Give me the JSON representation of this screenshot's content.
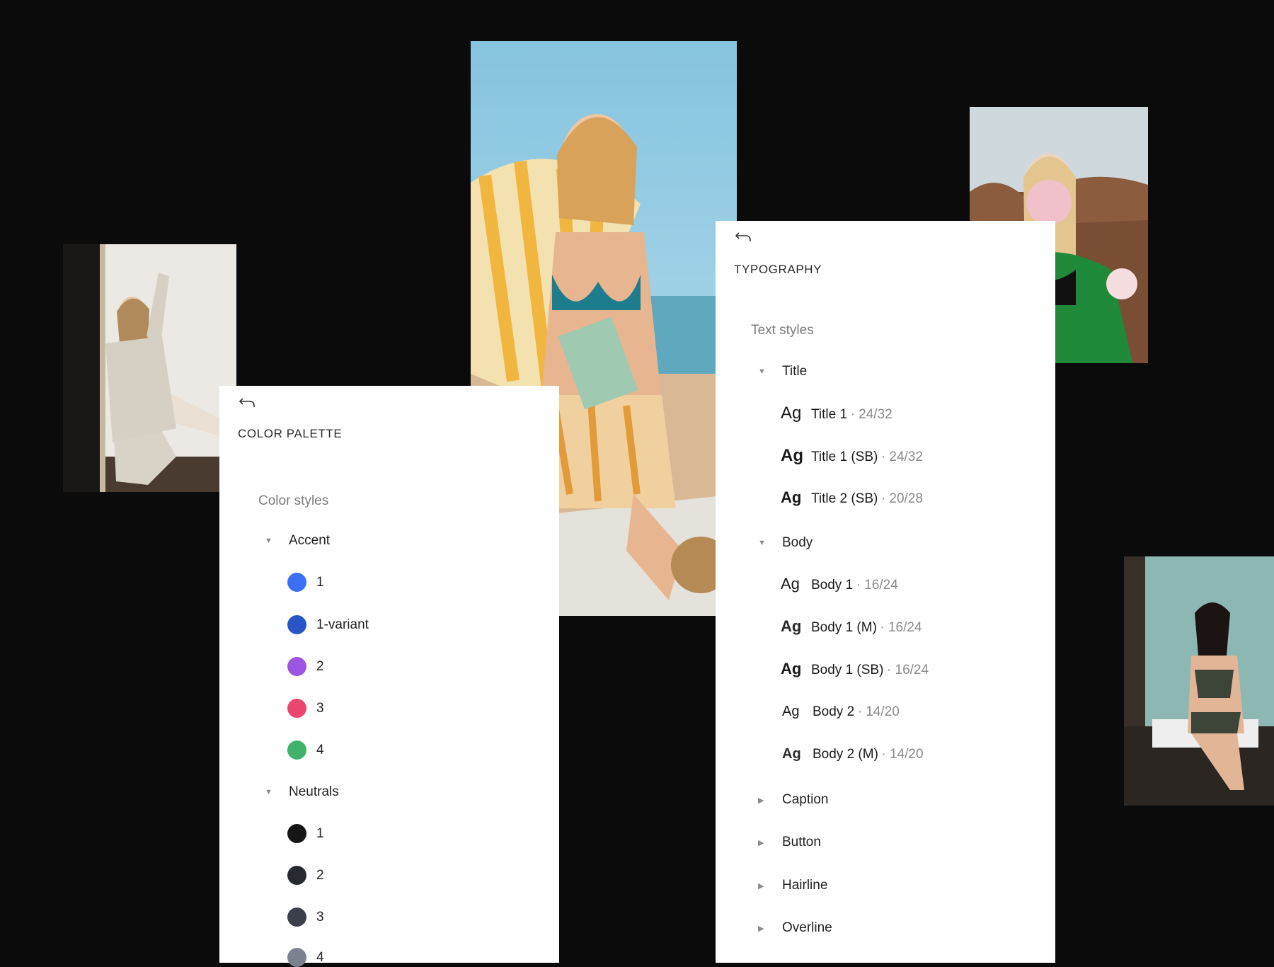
{
  "color_panel": {
    "title": "COLOR PALETTE",
    "section": "Color styles",
    "groups": [
      {
        "label": "Accent",
        "expanded": true,
        "swatches": [
          {
            "label": "1",
            "color": "#3b6ff5"
          },
          {
            "label": "1-variant",
            "color": "#2a55c9"
          },
          {
            "label": "2",
            "color": "#9b55e0"
          },
          {
            "label": "3",
            "color": "#ea4670"
          },
          {
            "label": "4",
            "color": "#3fb36b"
          }
        ]
      },
      {
        "label": "Neutrals",
        "expanded": true,
        "swatches": [
          {
            "label": "1",
            "color": "#161616"
          },
          {
            "label": "2",
            "color": "#272a30"
          },
          {
            "label": "3",
            "color": "#3a3f4b"
          },
          {
            "label": "4",
            "color": "#7c8190"
          }
        ]
      }
    ]
  },
  "typography_panel": {
    "title": "TYPOGRAPHY",
    "section": "Text styles",
    "groups": [
      {
        "label": "Title",
        "expanded": true,
        "styles": [
          {
            "ag": "Ag",
            "name": "Title 1",
            "spec": "· 24/32"
          },
          {
            "ag": "Ag",
            "name": "Title 1 (SB)",
            "spec": "· 24/32"
          },
          {
            "ag": "Ag",
            "name": "Title 2 (SB)",
            "spec": "· 20/28"
          }
        ]
      },
      {
        "label": "Body",
        "expanded": true,
        "styles": [
          {
            "ag": "Ag",
            "name": "Body 1",
            "spec": "· 16/24"
          },
          {
            "ag": "Ag",
            "name": "Body 1 (M)",
            "spec": "· 16/24"
          },
          {
            "ag": "Ag",
            "name": "Body 1 (SB)",
            "spec": "· 16/24"
          },
          {
            "ag": "Ag",
            "name": "Body 2",
            "spec": "· 14/20"
          },
          {
            "ag": "Ag",
            "name": "Body 2 (M)",
            "spec": "· 14/20"
          }
        ]
      },
      {
        "label": "Caption",
        "expanded": false,
        "styles": []
      },
      {
        "label": "Button",
        "expanded": false,
        "styles": []
      },
      {
        "label": "Hairline",
        "expanded": false,
        "styles": []
      },
      {
        "label": "Overline",
        "expanded": false,
        "styles": []
      }
    ]
  },
  "icons": {
    "back": "back-arrow-icon",
    "expanded": "caret-down-icon",
    "collapsed": "caret-right-icon"
  },
  "colors": {
    "background": "#0b0b0b",
    "panel": "#ffffff",
    "muted_text": "#8a8a8a"
  }
}
